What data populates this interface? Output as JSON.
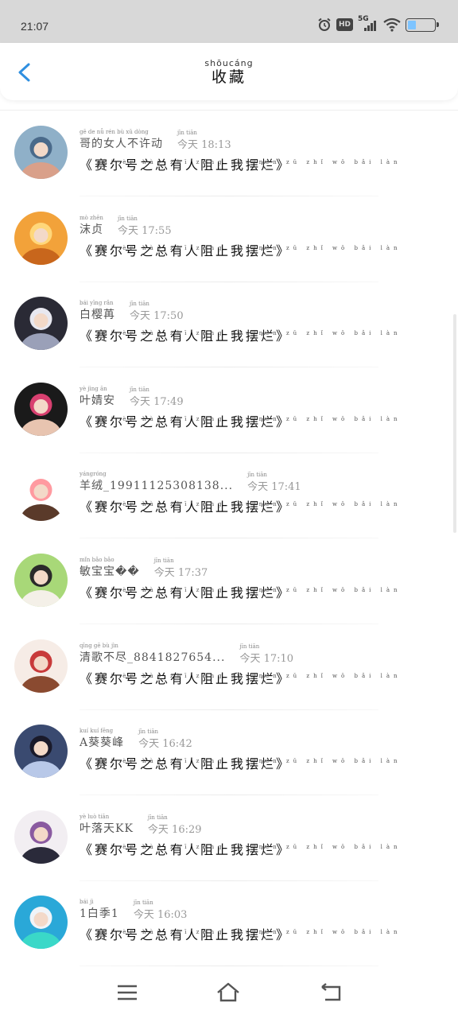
{
  "status_bar": {
    "time": "21:07",
    "hd": "HD",
    "network": "5G",
    "icons": [
      "alarm-icon",
      "hd-icon",
      "5g-signal-icon",
      "wifi-icon",
      "battery-icon"
    ]
  },
  "header": {
    "title_pinyin": "shōucáng",
    "title": "收藏",
    "back_icon": "chevron-left-icon",
    "accent_color": "#2f8fe0"
  },
  "items": [
    {
      "name_pinyin": "gē de nǚ rén bù xǔ dòng",
      "name": "哥的女人不许动",
      "time_pinyin": "jīn tiān",
      "time": "今天 18:13",
      "novel_pinyin": "sài èr hào zhī zǒng yǒu rén zǔ zhǐ wǒ bǎi làn",
      "novel": "《赛尔号之总有人阻止我摆烂》",
      "avatar_colors": [
        "#8fb0c8",
        "#d9a08a",
        "#4a6a8a"
      ]
    },
    {
      "name_pinyin": "mò zhēn",
      "name": "沫贞",
      "time_pinyin": "jīn tiān",
      "time": "今天 17:55",
      "novel_pinyin": "sài èr hào zhī zǒng yǒu rén zǔ zhǐ wǒ bǎi làn",
      "novel": "《赛尔号之总有人阻止我摆烂》",
      "avatar_colors": [
        "#f2a23a",
        "#c8661c",
        "#ffd77a"
      ]
    },
    {
      "name_pinyin": "bái yīng rǎn",
      "name": "白樱苒",
      "time_pinyin": "jīn tiān",
      "time": "今天 17:50",
      "novel_pinyin": "sài èr hào zhī zǒng yǒu rén zǔ zhǐ wǒ bǎi làn",
      "novel": "《赛尔号之总有人阻止我摆烂》",
      "avatar_colors": [
        "#2a2a35",
        "#9aa0b8",
        "#e8e8f0"
      ]
    },
    {
      "name_pinyin": "yè jìng ān",
      "name": "叶婧安",
      "time_pinyin": "jīn tiān",
      "time": "今天 17:49",
      "novel_pinyin": "sài èr hào zhī zǒng yǒu rén zǔ zhǐ wǒ bǎi làn",
      "novel": "《赛尔号之总有人阻止我摆烂》",
      "avatar_colors": [
        "#1a1a1a",
        "#e8c4b0",
        "#d84070"
      ]
    },
    {
      "name_pinyin": "yángróng",
      "name": "羊绒_19911125308138...",
      "time_pinyin": "jīn tiān",
      "time": "今天 17:41",
      "novel_pinyin": "sài èr hào zhī zǒng yǒu rén zǔ zhǐ wǒ bǎi làn",
      "novel": "《赛尔号之总有人阻止我摆烂》",
      "avatar_colors": [
        "#ffffff",
        "#5a3a2a",
        "#ff9aa0"
      ]
    },
    {
      "name_pinyin": "mǐn bǎo bǎo",
      "name": "敏宝宝��",
      "time_pinyin": "jīn tiān",
      "time": "今天 17:37",
      "novel_pinyin": "sài èr hào zhī zǒng yǒu rén zǔ zhǐ wǒ bǎi làn",
      "novel": "《赛尔号之总有人阻止我摆烂》",
      "avatar_colors": [
        "#a8d878",
        "#f4f0e8",
        "#2a2a2a"
      ]
    },
    {
      "name_pinyin": "qīng gē bù jìn",
      "name": "清歌不尽_8841827654...",
      "time_pinyin": "jīn tiān",
      "time": "今天 17:10",
      "novel_pinyin": "sài èr hào zhī zǒng yǒu rén zǔ zhǐ wǒ bǎi làn",
      "novel": "《赛尔号之总有人阻止我摆烂》",
      "avatar_colors": [
        "#f6ece6",
        "#8a4a30",
        "#c83a3a"
      ]
    },
    {
      "name_pinyin": "kuí kuí fēng",
      "name": "A葵葵峰",
      "time_pinyin": "jīn tiān",
      "time": "今天 16:42",
      "novel_pinyin": "sài èr hào zhī zǒng yǒu rén zǔ zhǐ wǒ bǎi làn",
      "novel": "《赛尔号之总有人阻止我摆烂》",
      "avatar_colors": [
        "#3a4a70",
        "#b8c8e8",
        "#1a1a2a"
      ]
    },
    {
      "name_pinyin": "yè luò tiān",
      "name": "叶落天KK",
      "time_pinyin": "jīn tiān",
      "time": "今天 16:29",
      "novel_pinyin": "sài èr hào zhī zǒng yǒu rén zǔ zhǐ wǒ bǎi làn",
      "novel": "《赛尔号之总有人阻止我摆烂》",
      "avatar_colors": [
        "#f2eef2",
        "#2a2a3a",
        "#8a5aa0"
      ]
    },
    {
      "name_pinyin": "bái jì",
      "name": "1白季1",
      "time_pinyin": "jīn tiān",
      "time": "今天 16:03",
      "novel_pinyin": "sài èr hào zhī zǒng yǒu rén zǔ zhǐ wǒ bǎi làn",
      "novel": "《赛尔号之总有人阻止我摆烂》",
      "avatar_colors": [
        "#2aa8d8",
        "#3ad8c8",
        "#f0f4f8"
      ]
    }
  ],
  "nav_bar": {
    "icons": [
      "menu-icon",
      "home-icon",
      "back-icon"
    ]
  }
}
